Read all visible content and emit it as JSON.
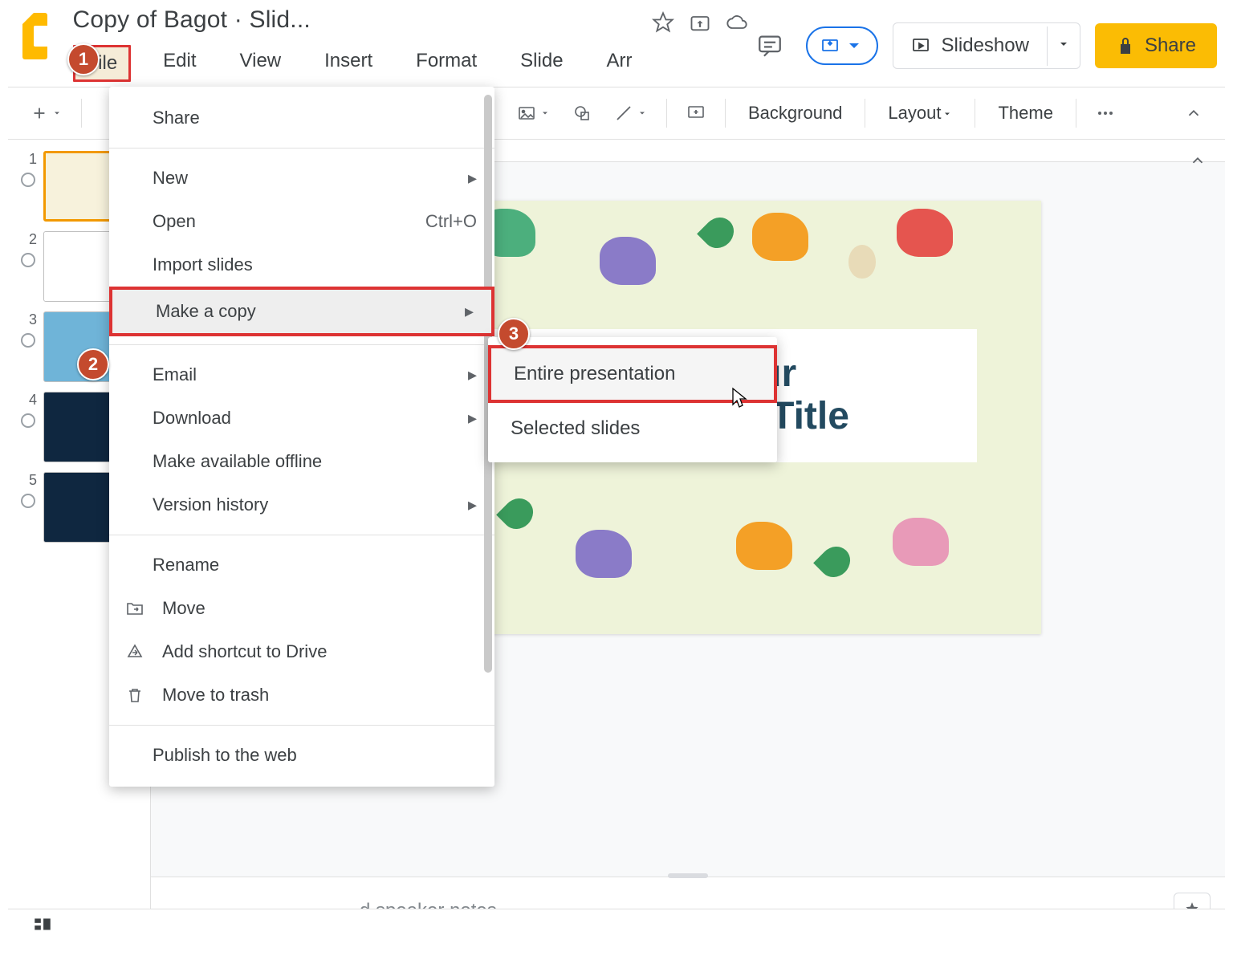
{
  "header": {
    "doc_title": "Copy of Bagot · Slid...",
    "slideshow_label": "Slideshow",
    "share_label": "Share"
  },
  "menubar": {
    "items": [
      "File",
      "Edit",
      "View",
      "Insert",
      "Format",
      "Slide",
      "Arr"
    ]
  },
  "toolbar": {
    "background": "Background",
    "layout": "Layout",
    "theme": "Theme"
  },
  "file_menu": {
    "share": "Share",
    "new": "New",
    "open": "Open",
    "open_shortcut": "Ctrl+O",
    "import_slides": "Import slides",
    "make_copy": "Make a copy",
    "email": "Email",
    "download": "Download",
    "offline": "Make available offline",
    "version_history": "Version history",
    "rename": "Rename",
    "move": "Move",
    "shortcut": "Add shortcut to Drive",
    "trash": "Move to trash",
    "publish": "Publish to the web"
  },
  "submenu": {
    "entire": "Entire presentation",
    "selected": "Selected slides"
  },
  "slide": {
    "title_line1": "This is Your",
    "title_line2": "Presentation Title"
  },
  "notes_placeholder": "d speaker notes",
  "badges": {
    "b1": "1",
    "b2": "2",
    "b3": "3"
  },
  "filmstrip": {
    "slides": [
      "1",
      "2",
      "3",
      "4",
      "5"
    ]
  }
}
